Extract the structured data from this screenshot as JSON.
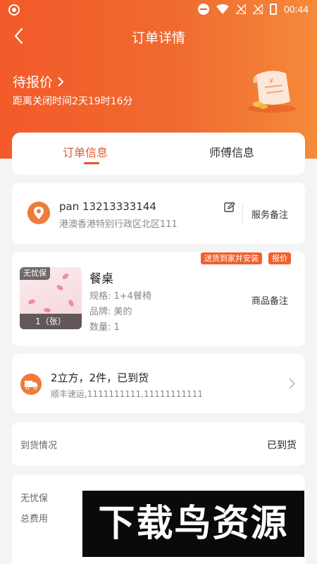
{
  "statusbar": {
    "time": "00:44"
  },
  "header": {
    "title": "订单详情"
  },
  "status": {
    "title": "待报价",
    "countdown": "距离关闭时间2天19时16分"
  },
  "tabs": [
    {
      "label": "订单信息",
      "active": true
    },
    {
      "label": "师傅信息",
      "active": false
    }
  ],
  "address": {
    "contact": "pan 13213333144",
    "address": "港澳香港特别行政区北区111",
    "remark_label": "服务备注"
  },
  "product": {
    "tags": [
      "送货到家并安装",
      "报价"
    ],
    "image_badge": "无忧保",
    "image_count": "1（张）",
    "name": "餐桌",
    "spec": "规格: 1+4餐椅",
    "brand": "品牌: 美的",
    "quantity": "数量: 1",
    "remark_label": "商品备注"
  },
  "shipping": {
    "summary": "2立方，2件，已到货",
    "detail": "顺丰速运,1111111111,11111111111"
  },
  "arrival": {
    "label": "到货情况",
    "value": "已到货"
  },
  "fees": {
    "label1": "无忧保",
    "label2": "总费用"
  },
  "watermark": "下载鸟资源",
  "colors": {
    "accent": "#f25a2a",
    "tag": "#f0612d"
  }
}
